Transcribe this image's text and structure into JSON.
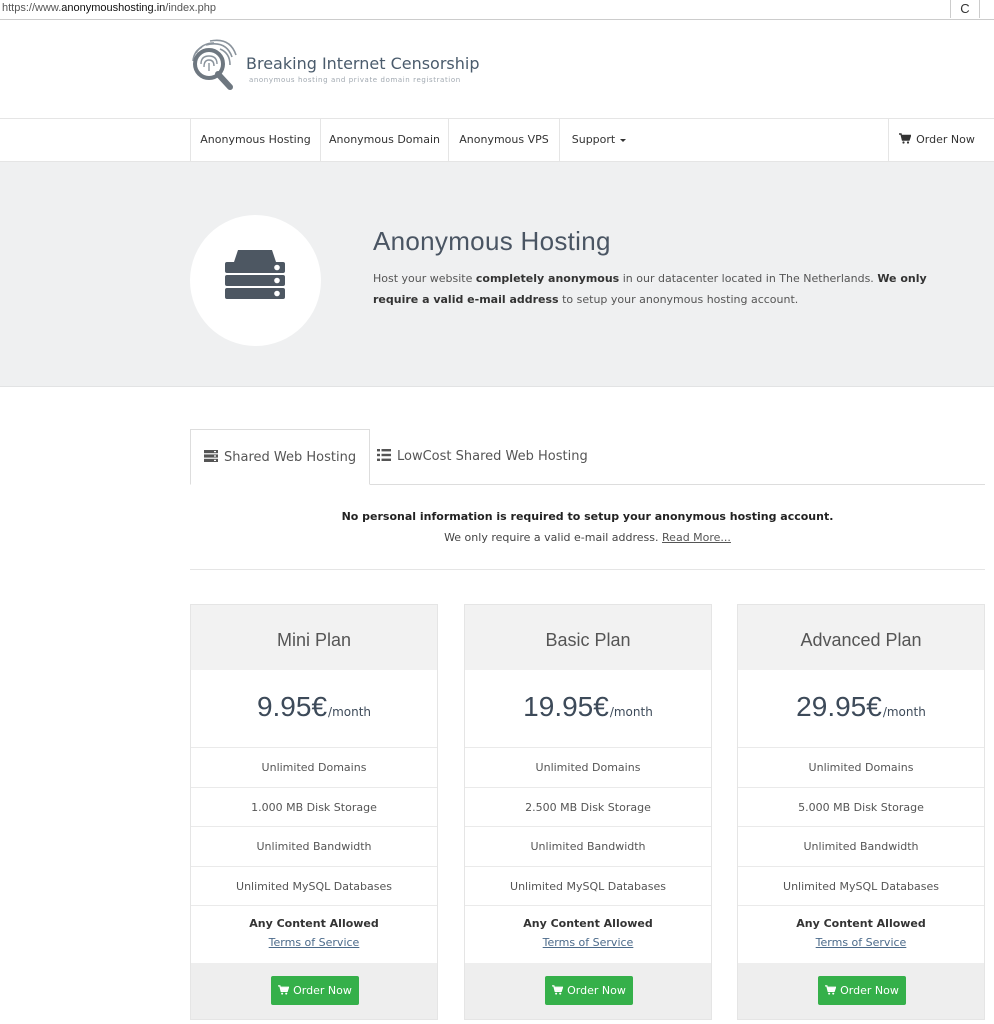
{
  "browser": {
    "url_prefix": "https://www.",
    "url_domain": "anonymoushosting.in",
    "url_path": "/index.php",
    "reload_label": "C"
  },
  "brand": {
    "title": "Breaking Internet Censorship",
    "subtitle": "anonymous hosting and private domain registration"
  },
  "nav": {
    "items": [
      {
        "label": "Anonymous Hosting"
      },
      {
        "label": "Anonymous Domain"
      },
      {
        "label": "Anonymous VPS"
      },
      {
        "label": "Support"
      }
    ],
    "order_label": "Order Now"
  },
  "hero": {
    "title": "Anonymous Hosting",
    "desc_1": "Host your website ",
    "desc_2": "completely anonymous",
    "desc_3": " in our datacenter located in The Netherlands. ",
    "desc_4": "We only require a valid e-mail address",
    "desc_5": " to setup your anonymous hosting account."
  },
  "tabs": [
    {
      "label": "Shared Web Hosting",
      "active": true
    },
    {
      "label": "LowCost Shared Web Hosting",
      "active": false
    }
  ],
  "info": {
    "line1": "No personal information is required to setup your anonymous hosting account.",
    "line2": "We only require a valid e-mail address. ",
    "read_more": "Read More..."
  },
  "plans": [
    {
      "name": "Mini Plan",
      "price": "9.95€",
      "period": "/month",
      "features": [
        "Unlimited Domains",
        "1.000 MB Disk Storage",
        "Unlimited Bandwidth",
        "Unlimited MySQL Databases"
      ],
      "content": "Any Content Allowed",
      "tos": "Terms of Service",
      "button": "Order Now"
    },
    {
      "name": "Basic Plan",
      "price": "19.95€",
      "period": "/month",
      "features": [
        "Unlimited Domains",
        "2.500 MB Disk Storage",
        "Unlimited Bandwidth",
        "Unlimited MySQL Databases"
      ],
      "content": "Any Content Allowed",
      "tos": "Terms of Service",
      "button": "Order Now"
    },
    {
      "name": "Advanced Plan",
      "price": "29.95€",
      "period": "/month",
      "features": [
        "Unlimited Domains",
        "5.000 MB Disk Storage",
        "Unlimited Bandwidth",
        "Unlimited MySQL Databases"
      ],
      "content": "Any Content Allowed",
      "tos": "Terms of Service",
      "button": "Order Now"
    }
  ],
  "colors": {
    "accent_green": "#35b04a",
    "hero_bg": "#eff0f1",
    "heading": "#4a5563"
  },
  "icons": {
    "logo": "fingerprint-magnifier-icon",
    "hero": "server-stack-icon",
    "cart": "cart-icon",
    "tab_shared": "server-icon",
    "tab_lowcost": "list-icon"
  }
}
